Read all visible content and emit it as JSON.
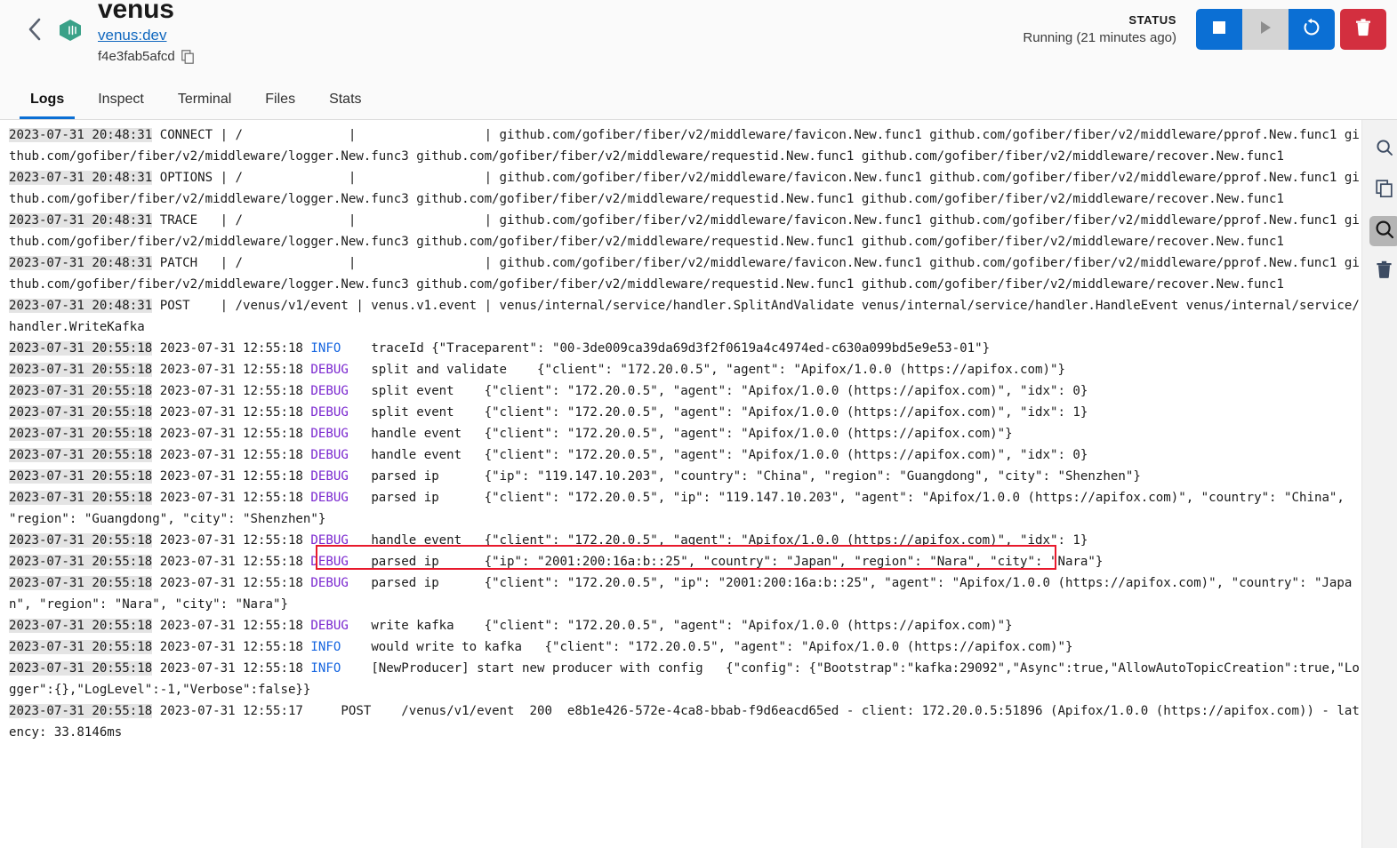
{
  "header": {
    "back_icon": "chevron-left-icon",
    "container_icon": "container-cube-icon",
    "container_name": "venus",
    "image_tag": "venus:dev",
    "container_id": "f4e3fab5afcd",
    "copy_icon": "copy-icon",
    "status_label": "STATUS",
    "status_value": "Running (21 minutes ago)",
    "controls": [
      {
        "name": "stop-button",
        "icon": "stop-icon",
        "color": "#0b6fd4"
      },
      {
        "name": "start-button",
        "icon": "play-icon",
        "color": "#d4d4d4"
      },
      {
        "name": "restart-button",
        "icon": "restart-icon",
        "color": "#0b6fd4"
      },
      {
        "name": "delete-button",
        "icon": "trash-icon",
        "color": "#d32f3f"
      }
    ]
  },
  "tabs": [
    {
      "label": "Logs",
      "active": true
    },
    {
      "label": "Inspect",
      "active": false
    },
    {
      "label": "Terminal",
      "active": false
    },
    {
      "label": "Files",
      "active": false
    },
    {
      "label": "Stats",
      "active": false
    }
  ],
  "right_rail": [
    {
      "name": "search-icon",
      "active": false
    },
    {
      "name": "copy-icon",
      "active": false
    },
    {
      "name": "zoom-search-icon",
      "active": true
    },
    {
      "name": "trash-icon",
      "active": false
    }
  ],
  "logs": {
    "annotation": {
      "shape": "rectangle",
      "color": "#e8192c",
      "target_text": "2023-07-31 20:55:18 2023-07-31 12:55:18 INFO    traceId {\"Traceparent\": \"00-3de009ca39da69d3f2f0619a4c4974ed-c630a099bd5e9e53-01\"}"
    },
    "lines": [
      {
        "ts": "2023-07-31 20:48:31",
        "level": "",
        "text": " CONNECT | /              |                 | github.com/gofiber/fiber/v2/middleware/favicon.New.func1 github.com/gofiber/fiber/v2/middleware/pprof.New.func1 github.com/gofiber/fiber/v2/middleware/logger.New.func3 github.com/gofiber/fiber/v2/middleware/requestid.New.func1 github.com/gofiber/fiber/v2/middleware/recover.New.func1"
      },
      {
        "ts": "2023-07-31 20:48:31",
        "level": "",
        "text": " OPTIONS | /              |                 | github.com/gofiber/fiber/v2/middleware/favicon.New.func1 github.com/gofiber/fiber/v2/middleware/pprof.New.func1 github.com/gofiber/fiber/v2/middleware/logger.New.func3 github.com/gofiber/fiber/v2/middleware/requestid.New.func1 github.com/gofiber/fiber/v2/middleware/recover.New.func1"
      },
      {
        "ts": "2023-07-31 20:48:31",
        "level": "",
        "text": " TRACE   | /              |                 | github.com/gofiber/fiber/v2/middleware/favicon.New.func1 github.com/gofiber/fiber/v2/middleware/pprof.New.func1 github.com/gofiber/fiber/v2/middleware/logger.New.func3 github.com/gofiber/fiber/v2/middleware/requestid.New.func1 github.com/gofiber/fiber/v2/middleware/recover.New.func1"
      },
      {
        "ts": "2023-07-31 20:48:31",
        "level": "",
        "text": " PATCH   | /              |                 | github.com/gofiber/fiber/v2/middleware/favicon.New.func1 github.com/gofiber/fiber/v2/middleware/pprof.New.func1 github.com/gofiber/fiber/v2/middleware/logger.New.func3 github.com/gofiber/fiber/v2/middleware/requestid.New.func1 github.com/gofiber/fiber/v2/middleware/recover.New.func1"
      },
      {
        "ts": "2023-07-31 20:48:31",
        "level": "",
        "text": " POST    | /venus/v1/event | venus.v1.event | venus/internal/service/handler.SplitAndValidate venus/internal/service/handler.HandleEvent venus/internal/service/handler.WriteKafka"
      },
      {
        "ts": "2023-07-31 20:55:18",
        "ts2": " 2023-07-31 12:55:18 ",
        "level": "INFO",
        "level_color": "info",
        "text": "    traceId {\"Traceparent\": \"00-3de009ca39da69d3f2f0619a4c4974ed-c630a099bd5e9e53-01\"}"
      },
      {
        "ts": "2023-07-31 20:55:18",
        "ts2": " 2023-07-31 12:55:18 ",
        "level": "DEBUG",
        "level_color": "debug",
        "text": "   split and validate    {\"client\": \"172.20.0.5\", \"agent\": \"Apifox/1.0.0 (https://apifox.com)\"}"
      },
      {
        "ts": "2023-07-31 20:55:18",
        "ts2": " 2023-07-31 12:55:18 ",
        "level": "DEBUG",
        "level_color": "debug",
        "text": "   split event    {\"client\": \"172.20.0.5\", \"agent\": \"Apifox/1.0.0 (https://apifox.com)\", \"idx\": 0}"
      },
      {
        "ts": "2023-07-31 20:55:18",
        "ts2": " 2023-07-31 12:55:18 ",
        "level": "DEBUG",
        "level_color": "debug",
        "text": "   split event    {\"client\": \"172.20.0.5\", \"agent\": \"Apifox/1.0.0 (https://apifox.com)\", \"idx\": 1}"
      },
      {
        "ts": "2023-07-31 20:55:18",
        "ts2": " 2023-07-31 12:55:18 ",
        "level": "DEBUG",
        "level_color": "debug",
        "text": "   handle event   {\"client\": \"172.20.0.5\", \"agent\": \"Apifox/1.0.0 (https://apifox.com)\"}"
      },
      {
        "ts": "2023-07-31 20:55:18",
        "ts2": " 2023-07-31 12:55:18 ",
        "level": "DEBUG",
        "level_color": "debug",
        "text": "   handle event   {\"client\": \"172.20.0.5\", \"agent\": \"Apifox/1.0.0 (https://apifox.com)\", \"idx\": 0}"
      },
      {
        "ts": "2023-07-31 20:55:18",
        "ts2": " 2023-07-31 12:55:18 ",
        "level": "DEBUG",
        "level_color": "debug",
        "text": "   parsed ip      {\"ip\": \"119.147.10.203\", \"country\": \"China\", \"region\": \"Guangdong\", \"city\": \"Shenzhen\"}"
      },
      {
        "ts": "2023-07-31 20:55:18",
        "ts2": " 2023-07-31 12:55:18 ",
        "level": "DEBUG",
        "level_color": "debug",
        "text": "   parsed ip      {\"client\": \"172.20.0.5\", \"ip\": \"119.147.10.203\", \"agent\": \"Apifox/1.0.0 (https://apifox.com)\", \"country\": \"China\", \"region\": \"Guangdong\", \"city\": \"Shenzhen\"}"
      },
      {
        "ts": "2023-07-31 20:55:18",
        "ts2": " 2023-07-31 12:55:18 ",
        "level": "DEBUG",
        "level_color": "debug",
        "text": "   handle event   {\"client\": \"172.20.0.5\", \"agent\": \"Apifox/1.0.0 (https://apifox.com)\", \"idx\": 1}"
      },
      {
        "ts": "2023-07-31 20:55:18",
        "ts2": " 2023-07-31 12:55:18 ",
        "level": "DEBUG",
        "level_color": "debug",
        "text": "   parsed ip      {\"ip\": \"2001:200:16a:b::25\", \"country\": \"Japan\", \"region\": \"Nara\", \"city\": \"Nara\"}"
      },
      {
        "ts": "2023-07-31 20:55:18",
        "ts2": " 2023-07-31 12:55:18 ",
        "level": "DEBUG",
        "level_color": "debug",
        "text": "   parsed ip      {\"client\": \"172.20.0.5\", \"ip\": \"2001:200:16a:b::25\", \"agent\": \"Apifox/1.0.0 (https://apifox.com)\", \"country\": \"Japan\", \"region\": \"Nara\", \"city\": \"Nara\"}"
      },
      {
        "ts": "2023-07-31 20:55:18",
        "ts2": " 2023-07-31 12:55:18 ",
        "level": "DEBUG",
        "level_color": "debug",
        "text": "   write kafka    {\"client\": \"172.20.0.5\", \"agent\": \"Apifox/1.0.0 (https://apifox.com)\"}"
      },
      {
        "ts": "2023-07-31 20:55:18",
        "ts2": " 2023-07-31 12:55:18 ",
        "level": "INFO",
        "level_color": "info",
        "text": "    would write to kafka   {\"client\": \"172.20.0.5\", \"agent\": \"Apifox/1.0.0 (https://apifox.com)\"}"
      },
      {
        "ts": "2023-07-31 20:55:18",
        "ts2": " 2023-07-31 12:55:18 ",
        "level": "INFO",
        "level_color": "info",
        "text": "    [NewProducer] start new producer with config   {\"config\": {\"Bootstrap\":\"kafka:29092\",\"Async\":true,\"AllowAutoTopicCreation\":true,\"Logger\":{},\"LogLevel\":-1,\"Verbose\":false}}"
      },
      {
        "ts": "2023-07-31 20:55:18",
        "ts2": " 2023-07-31 12:55:17 ",
        "level": "",
        "text": "    POST    /venus/v1/event  200  e8b1e426-572e-4ca8-bbab-f9d6eacd65ed - client: 172.20.0.5:51896 (Apifox/1.0.0 (https://apifox.com)) - latency: 33.8146ms"
      }
    ]
  }
}
